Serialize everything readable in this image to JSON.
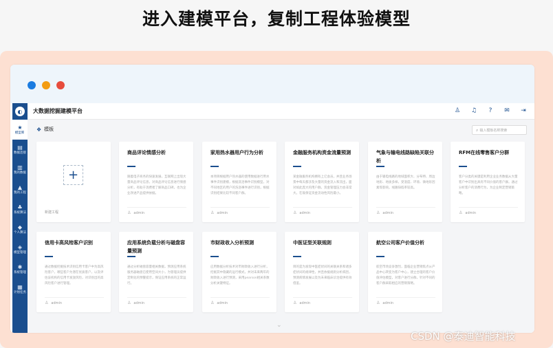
{
  "headline": "进入建模平台，复制工程体验模型",
  "app": {
    "brand": "大数据挖掘建模平台",
    "top_icons": [
      "user-icon",
      "bell-icon",
      "help-icon",
      "mail-icon",
      "logout-icon"
    ],
    "sidebar": [
      {
        "label": "模型库",
        "icon": "star-icon",
        "active": true
      },
      {
        "label": "数据连接",
        "icon": "database-icon",
        "active": false
      },
      {
        "label": "我的数据",
        "icon": "file-icon",
        "active": false
      },
      {
        "label": "我的工程",
        "icon": "project-icon",
        "active": false
      },
      {
        "label": "系统算法",
        "icon": "algorithm-icon",
        "active": false
      },
      {
        "label": "个人算法",
        "icon": "cube-icon",
        "active": false
      },
      {
        "label": "模型管理",
        "icon": "model-icon",
        "active": false
      },
      {
        "label": "系统管理",
        "icon": "settings-icon",
        "active": false
      },
      {
        "label": "计划任务",
        "icon": "calendar-icon",
        "active": false
      }
    ],
    "breadcrumb": "模板",
    "search_placeholder": "输入模板名称搜索",
    "new_project_label": "新建工程",
    "cards_row1": [
      {
        "title": "商品评论情感分析",
        "desc": "随着电子商务的快速发展，互联网上出现大量商品评论信息，对商品评论信息进行情感分析，有助于消费者了解商品口碑，也为企业改进产品提供依据。",
        "author": "admin"
      },
      {
        "title": "家用热水器用户行为分析",
        "desc": "本项目根据用户热水器的使用数据进行用水事件识别建模，根据洗浴事件识别模型，对不同地区的用户的洗浴事件进行识别，根据识别结果比较不同客户群。",
        "author": "admin"
      },
      {
        "title": "金融服务机构资金流量预测",
        "desc": "某金融服务机构拥有上亿会员，并且业务场景中每天都涉及大量的资金流入和流出，面对如此庞大的用户群，资金管理压力会非常大。在既保证资金流动性风险最小。",
        "author": "admin"
      },
      {
        "title": "气象与输电线路缺陷关联分析",
        "desc": "由于输电线路的地域面积大、分布特、周边地形、地质多样，受温度、环境、微地形因素等影响，线路缺陷率较高。",
        "author": "admin"
      },
      {
        "title": "RFM在线零售客户分群",
        "desc": "客户分类的关键是利用企业业务数据从大量客户中识别出具有不同价值的客户群。通过分析客户的消费行为，为企业制定营销策略。",
        "author": "admin"
      }
    ],
    "cards_row2": [
      {
        "title": "信用卡高风险客户识别",
        "desc": "通过数据挖掘技术识别信用卡客户中为高风险客户，哪些客户为潜在优质客户，以及评估该机构的信用卡发放风险，对识别出的高风险客户进行管理。",
        "author": "admin"
      },
      {
        "title": "应用系统负载分析与磁盘容量预测",
        "desc": "通过分析磁盘容量相关数据，预测应用系统服务器磁盘已使用空间大小，为管理员提供定制化的预警提示，保证应用系统的正常运行。",
        "author": "admin"
      },
      {
        "title": "市财政收入分析预测",
        "desc": "应用数据分析技术对市财政收入进行分析，挖掘其中隐藏的运行模式，并对未来两年的财政收入进行预测，采用pearson相关系数分析关键特征。",
        "author": "admin"
      },
      {
        "title": "中医证型关联规则",
        "desc": "目的是为发现中医症状间的关联关系和诸多症状间的规律性，并且依据规则分析病因，预测病情发展以及为未来临床诊治提供有效借鉴。",
        "author": "admin"
      },
      {
        "title": "航空公司客户价值分析",
        "desc": "航空市场竞争激烈，面临企业营销焦点从产品中心转变为客户中心，建立合理的客户价值评估模型，对客户进行分群，针对不同的客户群采取相应的营销策略。",
        "author": "admin"
      }
    ]
  },
  "window_dots": [
    "#1a7be0",
    "#f39c12",
    "#e74c3c"
  ],
  "watermark": "CSDN @泰迪智能科技"
}
